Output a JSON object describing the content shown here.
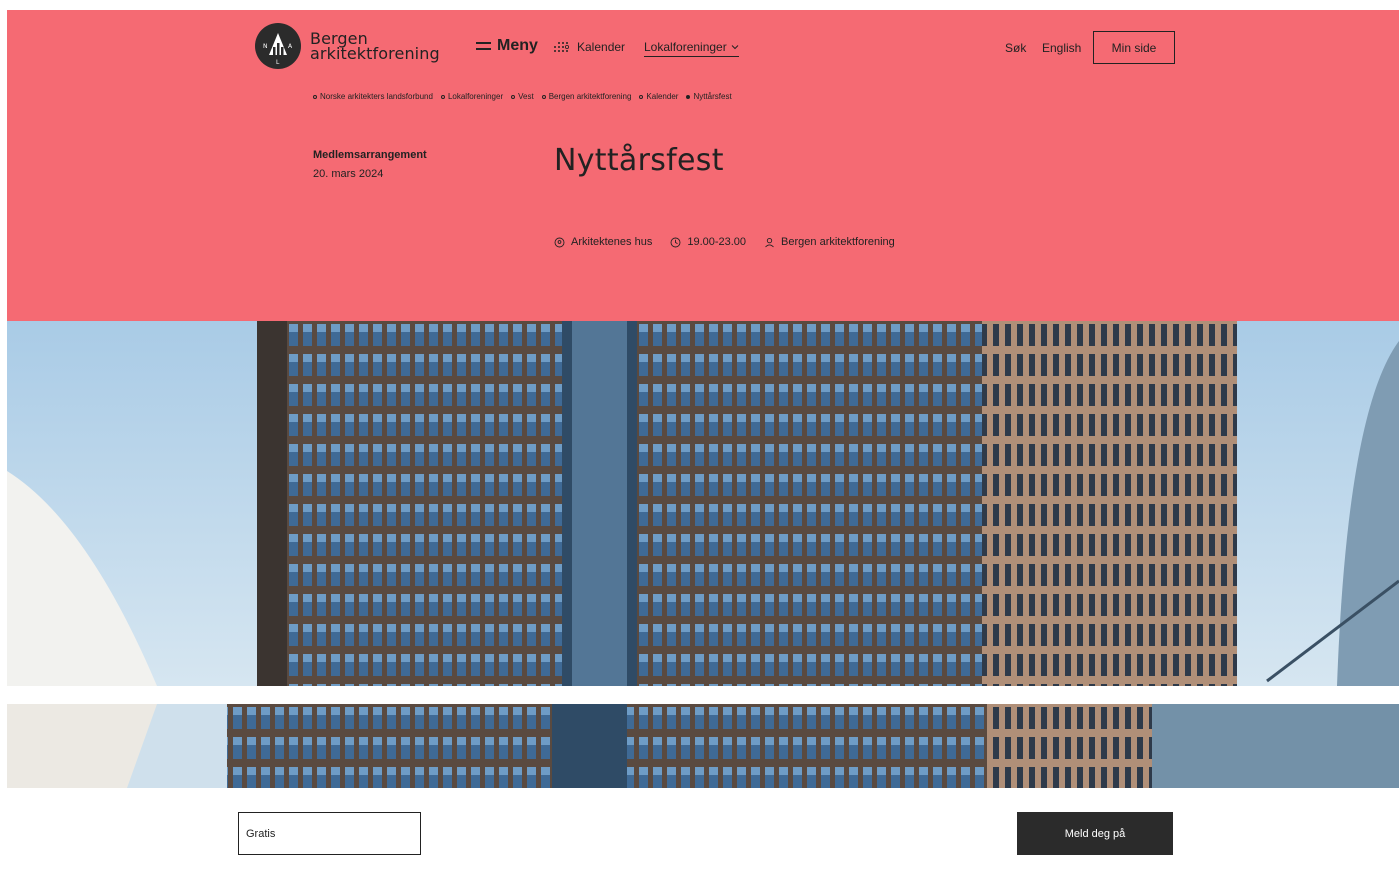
{
  "header": {
    "logo_line1": "Bergen",
    "logo_line2": "arkitektforening",
    "logo_badge_letters": [
      "N",
      "A",
      "L"
    ],
    "menu_label": "Meny",
    "calendar_label": "Kalender",
    "local_label": "Lokalforeninger",
    "search_label": "Søk",
    "language_label": "English",
    "my_page_label": "Min side"
  },
  "breadcrumb": [
    {
      "label": "Norske arkitekters landsforbund"
    },
    {
      "label": "Lokalforeninger"
    },
    {
      "label": "Vest"
    },
    {
      "label": "Bergen arkitektforening"
    },
    {
      "label": "Kalender"
    },
    {
      "label": "Nyttårsfest"
    }
  ],
  "event": {
    "type": "Medlemsarrangement",
    "date": "20. mars 2024",
    "title": "Nyttårsfest",
    "location": "Arkitektenes hus",
    "time": "19.00-23.00",
    "organizer": "Bergen arkitektforening"
  },
  "signup": {
    "price": "Gratis",
    "button_label": "Meld deg på"
  },
  "colors": {
    "hero_background": "#f56a73",
    "button_dark": "#2b2b2b",
    "text": "#222222"
  },
  "icons": {
    "menu": "hamburger-icon",
    "calendar": "dots-grid-icon",
    "dropdown": "chevron-down-icon",
    "location": "location-pin-icon",
    "time": "clock-icon",
    "organizer": "person-icon"
  }
}
